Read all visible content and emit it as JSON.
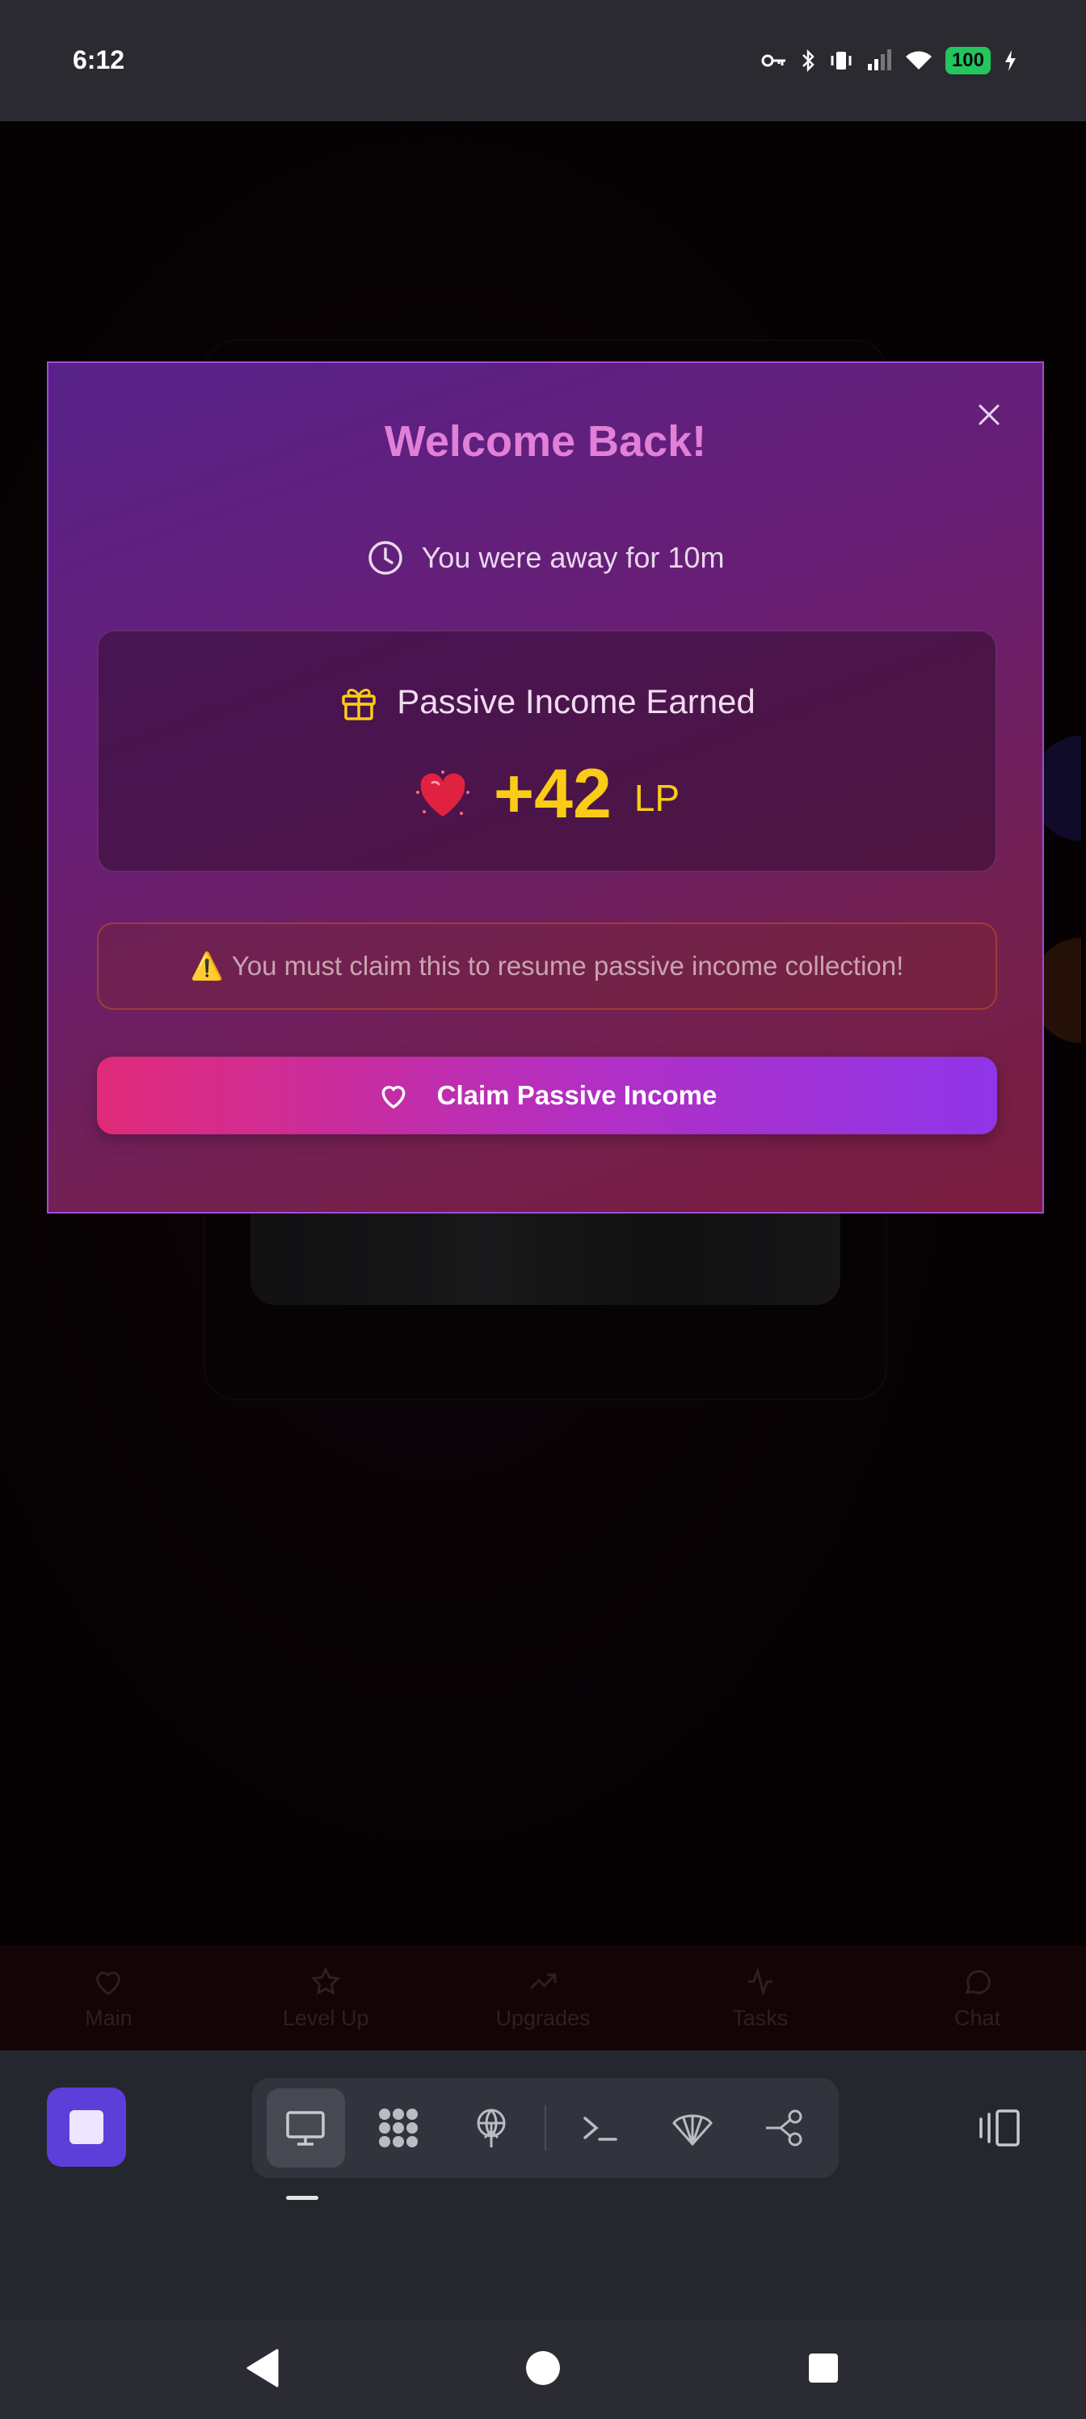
{
  "status_bar": {
    "time": "6:12",
    "battery": "100"
  },
  "modal": {
    "title": "Welcome Back!",
    "away_text": "You were away for 10m",
    "income_label": "Passive Income Earned",
    "income_amount": "+42",
    "income_unit": "LP",
    "warning_icon": "⚠️",
    "warning_text": "You must claim this to resume passive income collection!",
    "claim_label": "Claim Passive Income"
  },
  "bottom_nav": {
    "items": [
      {
        "label": "Main",
        "icon": "heart-icon"
      },
      {
        "label": "Level Up",
        "icon": "star-icon"
      },
      {
        "label": "Upgrades",
        "icon": "trending-up-icon"
      },
      {
        "label": "Tasks",
        "icon": "activity-icon"
      },
      {
        "label": "Chat",
        "icon": "chat-bubble-icon"
      }
    ]
  },
  "taskbar": {
    "items": [
      "desktop-icon",
      "apps-grid-icon",
      "broadcast-icon",
      "terminal-icon",
      "shell-icon",
      "share-nodes-icon"
    ]
  },
  "colors": {
    "accent_pink": "#e02a78",
    "accent_purple": "#8f35e8",
    "gold": "#facc15",
    "title_pink": "#e27fd6"
  }
}
